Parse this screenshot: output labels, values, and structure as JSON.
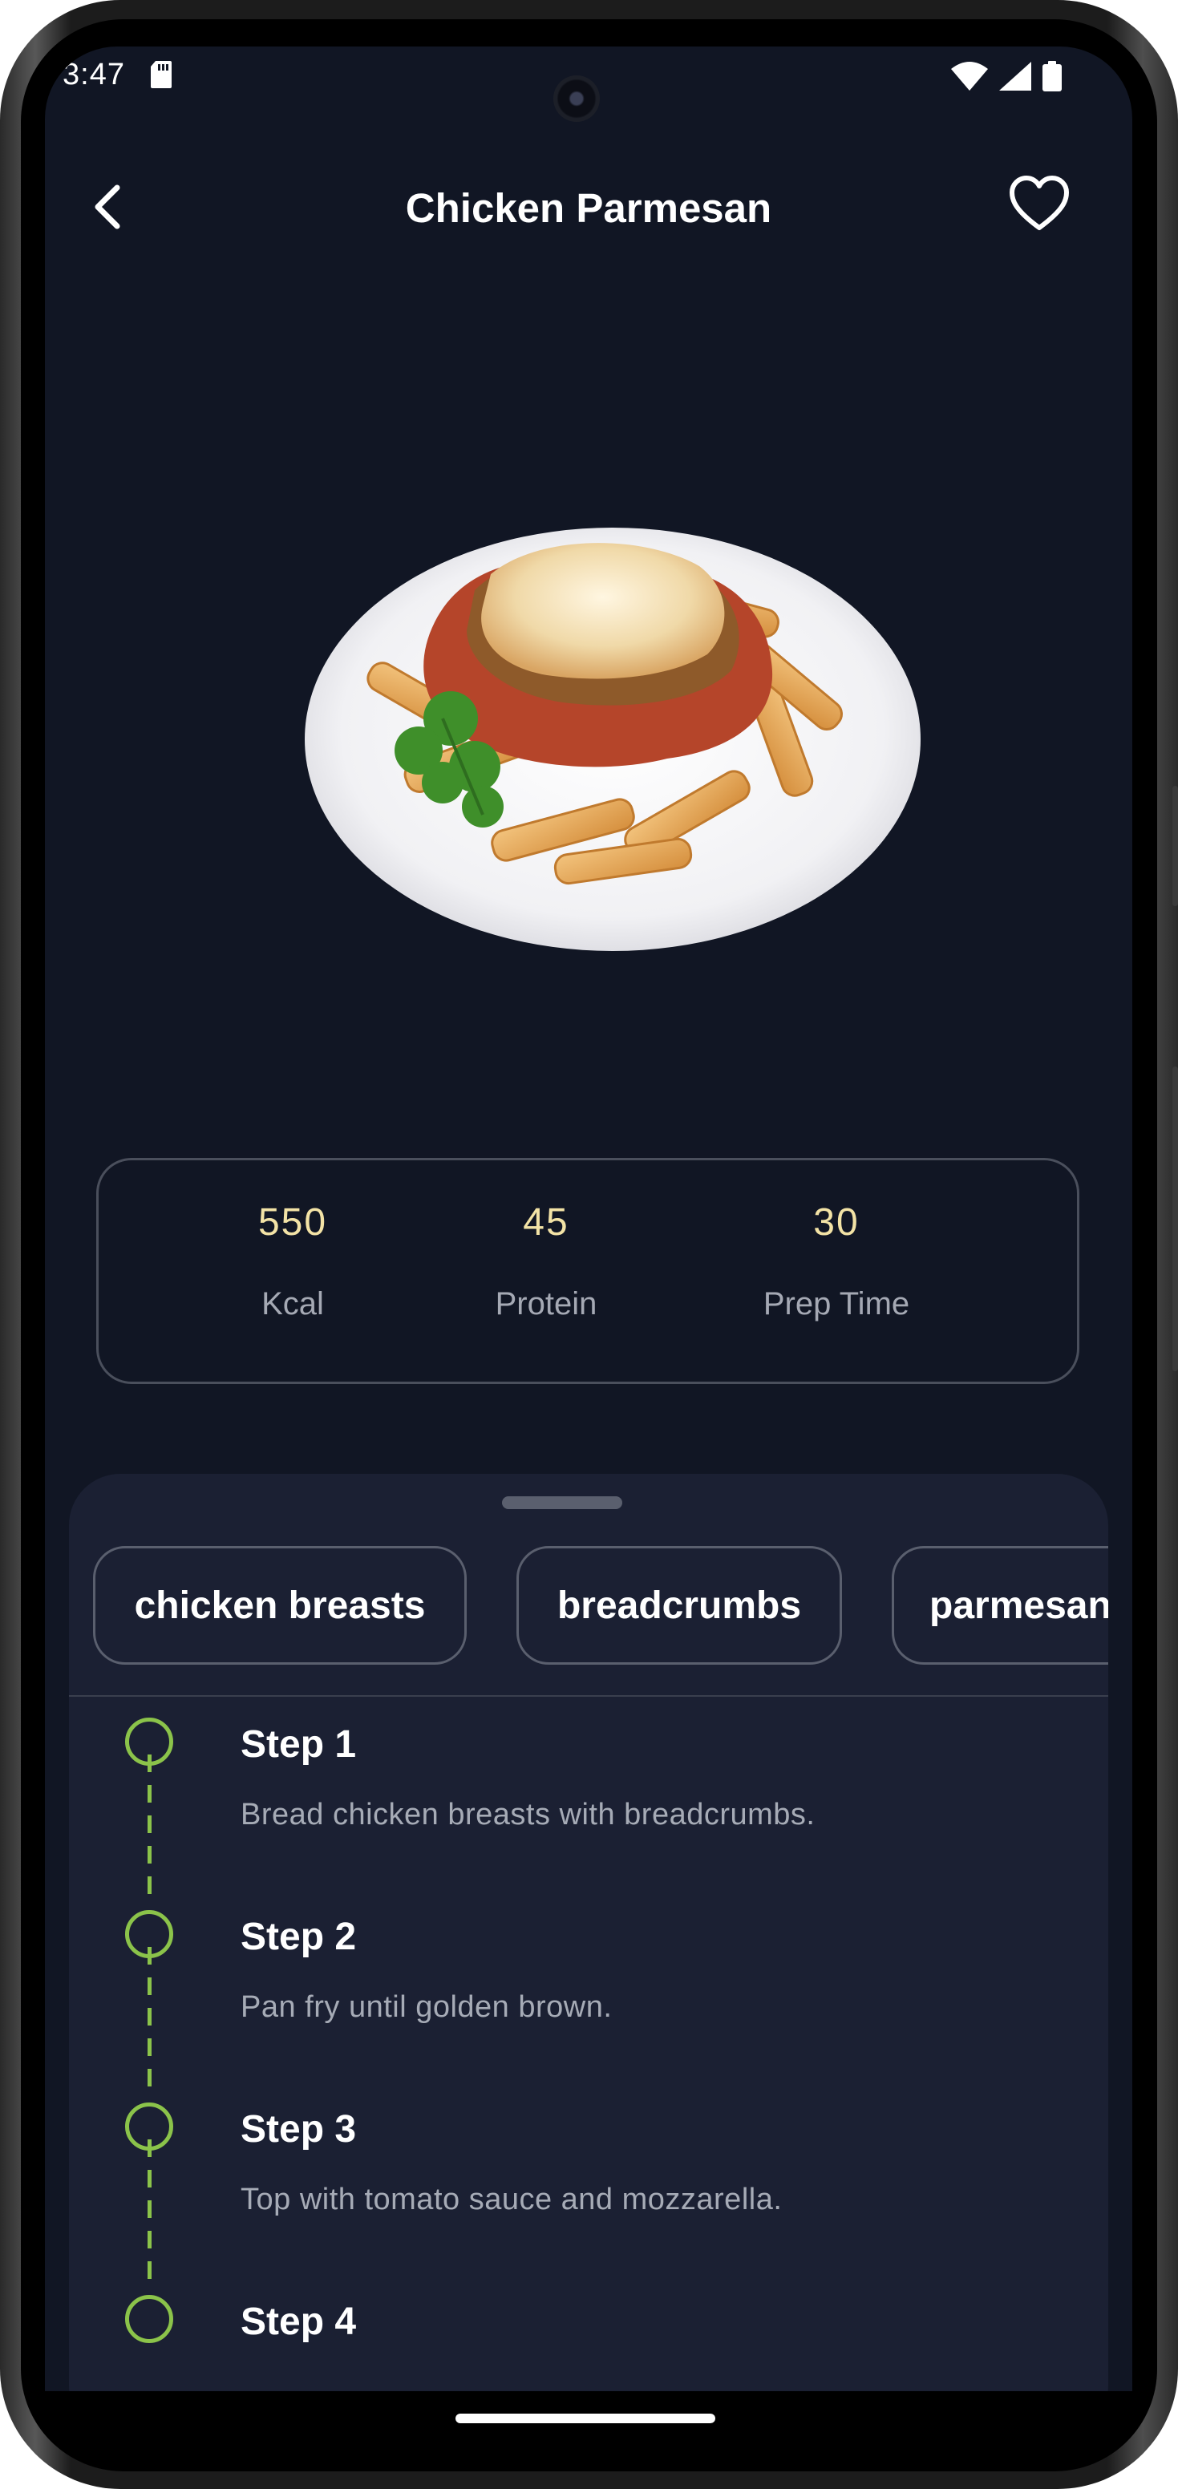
{
  "status_bar": {
    "time": "3:47",
    "icons": [
      "sd-card-icon",
      "wifi-icon",
      "signal-icon",
      "battery-icon"
    ]
  },
  "app_bar": {
    "title": "Chicken Parmesan",
    "back_icon": "chevron-left-icon",
    "favorite_icon": "heart-outline-icon"
  },
  "nutrition": [
    {
      "value": "550",
      "label": "Kcal"
    },
    {
      "value": "45",
      "label": "Protein"
    },
    {
      "value": "30",
      "label": "Prep Time"
    }
  ],
  "ingredients": [
    "chicken breasts",
    "breadcrumbs",
    "parmesan"
  ],
  "steps": [
    {
      "title": "Step 1",
      "description": "Bread chicken breasts with breadcrumbs."
    },
    {
      "title": "Step 2",
      "description": "Pan fry until golden brown."
    },
    {
      "title": "Step 3",
      "description": "Top with tomato sauce and mozzarella."
    },
    {
      "title": "Step 4",
      "description": ""
    }
  ],
  "colors": {
    "background": "#111624",
    "sheet": "#1b2033",
    "accent_green": "#8bc34a",
    "stat_value": "#f3e3a6"
  }
}
